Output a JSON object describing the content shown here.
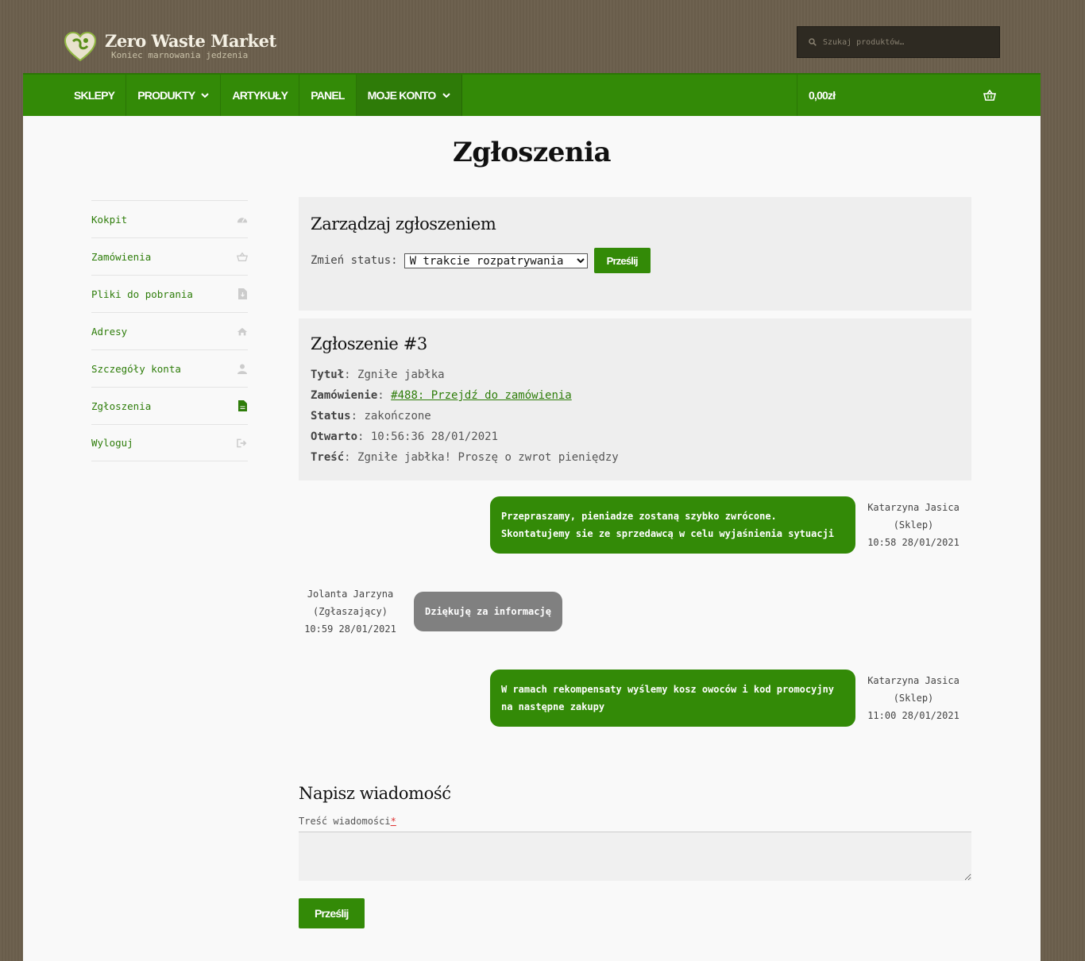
{
  "header": {
    "logo_title": "Zero Waste Market",
    "logo_subtitle": "Koniec marnowania jedzenia",
    "search_placeholder": "Szukaj produktów…"
  },
  "nav": {
    "items": [
      {
        "label": "SKLEPY",
        "has_dropdown": false
      },
      {
        "label": "PRODUKTY",
        "has_dropdown": true
      },
      {
        "label": "ARTYKUŁY",
        "has_dropdown": false
      },
      {
        "label": "PANEL",
        "has_dropdown": false
      },
      {
        "label": "MOJE KONTO",
        "has_dropdown": true
      }
    ],
    "cart_amount": "0,00zł"
  },
  "page": {
    "title": "Zgłoszenia"
  },
  "sidebar": {
    "items": [
      {
        "label": "Kokpit",
        "icon": "dashboard-icon"
      },
      {
        "label": "Zamówienia",
        "icon": "basket-icon"
      },
      {
        "label": "Pliki do pobrania",
        "icon": "file-download-icon"
      },
      {
        "label": "Adresy",
        "icon": "home-icon"
      },
      {
        "label": "Szczegóły konta",
        "icon": "user-icon"
      },
      {
        "label": "Zgłoszenia",
        "icon": "document-icon"
      },
      {
        "label": "Wyloguj",
        "icon": "logout-icon"
      }
    ]
  },
  "manage": {
    "heading": "Zarządzaj zgłoszeniem",
    "status_label": "Zmień status:",
    "status_selected": "W trakcie rozpatrywania",
    "submit_label": "Prześlij"
  },
  "ticket": {
    "heading": "Zgłoszenie #3",
    "title_label": "Tytuł",
    "title_value": "Zgniłe jabłka",
    "order_label": "Zamówienie",
    "order_link": "#488: Przejdź do zamówienia",
    "status_label": "Status",
    "status_value": "zakończone",
    "opened_label": "Otwarto",
    "opened_value": "10:56:36 28/01/2021",
    "content_label": "Treść",
    "content_value": "Zgniłe jabłka! Proszę o zwrot pieniędzy"
  },
  "messages": [
    {
      "side": "right",
      "text": "Przepraszamy, pieniadze zostaną szybko zwrócone. Skontatujemy sie ze sprzedawcą w celu wyjaśnienia sytuacji",
      "author": "Katarzyna Jasica",
      "role": "(Sklep)",
      "time": "10:58 28/01/2021"
    },
    {
      "side": "left",
      "text": "Dziękuję za informację",
      "author": "Jolanta Jarzyna",
      "role": "(Zgłaszający)",
      "time": "10:59 28/01/2021"
    },
    {
      "side": "right",
      "text": "W ramach rekompensaty wyślemy kosz owoców i kod promocyjny na następne zakupy",
      "author": "Katarzyna Jasica",
      "role": "(Sklep)",
      "time": "11:00 28/01/2021"
    }
  ],
  "write": {
    "heading": "Napisz wiadomość",
    "field_label": "Treść wiadomości",
    "required_mark": "*",
    "submit_label": "Prześlij"
  },
  "colors": {
    "brand_green": "#338a07",
    "link_green": "#2e7d0a",
    "background": "#6b5f4c",
    "gray_bubble": "#808080"
  }
}
